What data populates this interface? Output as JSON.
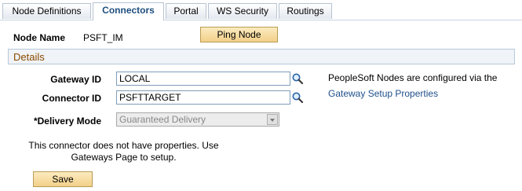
{
  "tabs": [
    {
      "label": "Node Definitions",
      "active": false
    },
    {
      "label": "Connectors",
      "active": true
    },
    {
      "label": "Portal",
      "active": false
    },
    {
      "label": "WS Security",
      "active": false
    },
    {
      "label": "Routings",
      "active": false
    }
  ],
  "node": {
    "name_label": "Node Name",
    "name_value": "PSFT_IM",
    "ping_button": "Ping Node"
  },
  "details": {
    "title": "Details",
    "gateway_label": "Gateway ID",
    "gateway_value": "LOCAL",
    "connector_label": "Connector ID",
    "connector_value": "PSFTTARGET",
    "delivery_label": "*Delivery Mode",
    "delivery_value": "Guaranteed Delivery",
    "info_text": "PeopleSoft Nodes are configured via the",
    "info_link": "Gateway Setup Properties"
  },
  "message": {
    "line1": "This connector does not have properties. Use",
    "line2": "Gateways Page to setup."
  },
  "save_button": "Save",
  "icons": {
    "lookup": "magnifier-lookup-icon",
    "dropdown": "chevron-down-icon"
  },
  "colors": {
    "active_tab_text": "#1e4e7e",
    "group_title": "#8a4a00",
    "button_fill": "#f2d089",
    "link": "#1f4f8a"
  }
}
